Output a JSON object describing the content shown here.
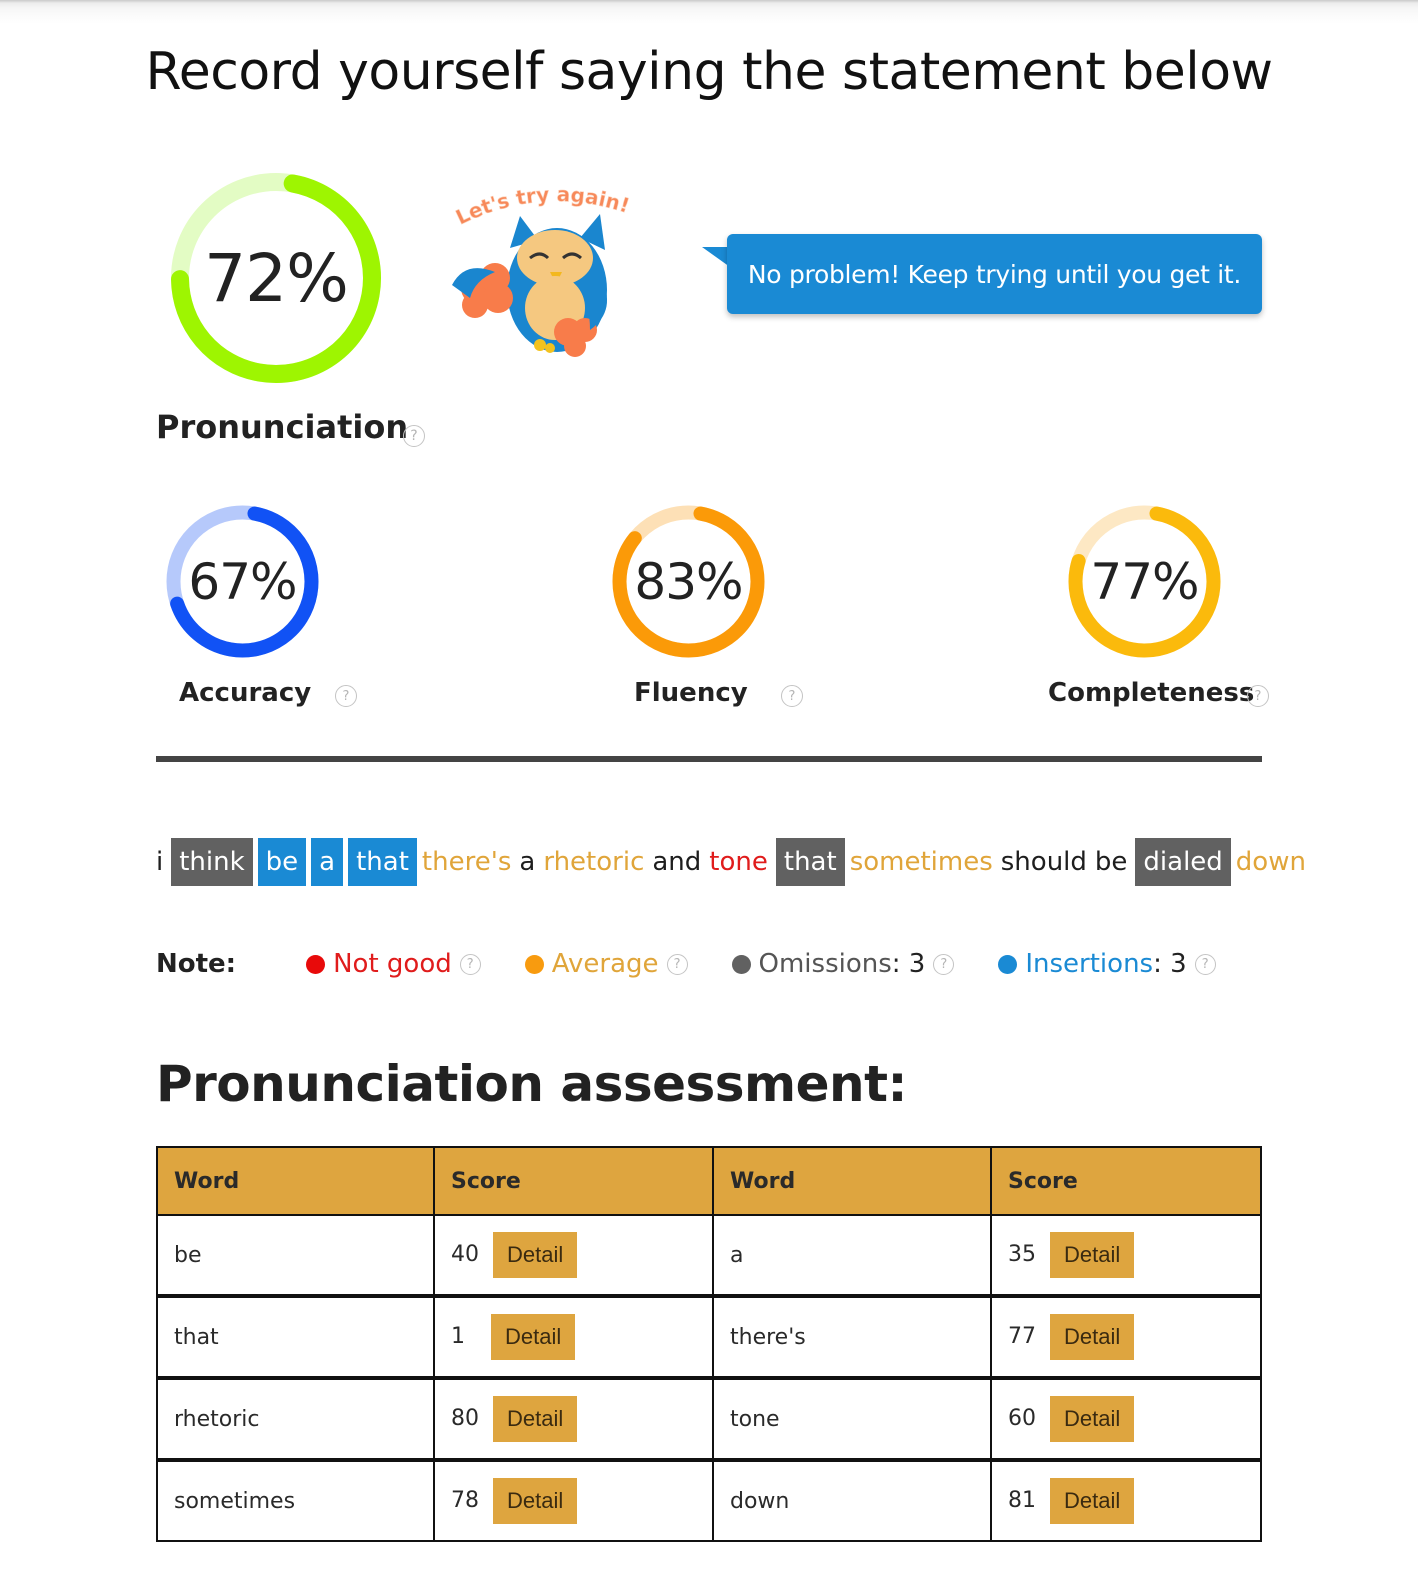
{
  "page": {
    "title": "Record yourself saying the statement below"
  },
  "main_score": {
    "label": "Pronunciation",
    "value": 72,
    "display": "72%",
    "color": "#9ef501",
    "track_color": "#e3fcc4",
    "help_icon": "question-circle-icon"
  },
  "mascot": {
    "caption": "Let's try again!",
    "icon": "owl-mascot-icon"
  },
  "feedback": {
    "message": "No problem! Keep trying until you get it."
  },
  "sub_scores": [
    {
      "label": "Accuracy",
      "value": 67,
      "display": "67%",
      "color": "#1152f5",
      "track_color": "#b6c9fb",
      "help_icon": "question-circle-icon"
    },
    {
      "label": "Fluency",
      "value": 83,
      "display": "83%",
      "color": "#fb9a08",
      "track_color": "#fde0b6",
      "help_icon": "question-circle-icon"
    },
    {
      "label": "Completeness",
      "value": 77,
      "display": "77%",
      "color": "#fbba0c",
      "track_color": "#fde8c4",
      "help_icon": "question-circle-icon"
    }
  ],
  "sentence": {
    "words": [
      {
        "text": "i",
        "status": "normal"
      },
      {
        "text": "think",
        "status": "omission"
      },
      {
        "text": "be",
        "status": "insertion"
      },
      {
        "text": "a",
        "status": "insertion"
      },
      {
        "text": "that",
        "status": "insertion"
      },
      {
        "text": "there's",
        "status": "average"
      },
      {
        "text": "a",
        "status": "normal"
      },
      {
        "text": "rhetoric",
        "status": "average"
      },
      {
        "text": "and",
        "status": "normal"
      },
      {
        "text": "tone",
        "status": "notgood"
      },
      {
        "text": "that",
        "status": "omission"
      },
      {
        "text": "sometimes",
        "status": "average"
      },
      {
        "text": "should",
        "status": "normal"
      },
      {
        "text": "be",
        "status": "normal"
      },
      {
        "text": "dialed",
        "status": "omission"
      },
      {
        "text": "down",
        "status": "average"
      }
    ]
  },
  "legend": {
    "label": "Note:",
    "items": [
      {
        "name": "Not good",
        "suffix": "",
        "color": "#e80a0a",
        "text_color": "#e01c1c"
      },
      {
        "name": "Average",
        "suffix": "",
        "color": "#f89b0f",
        "text_color": "#e0a53a"
      },
      {
        "name": "Omissions",
        "suffix": ": 3",
        "color": "#616161",
        "text_color": "#555555"
      },
      {
        "name": "Insertions",
        "suffix": ": 3",
        "color": "#1a8ad4",
        "text_color": "#1a8ad4"
      }
    ]
  },
  "assessment": {
    "heading": "Pronunciation assessment:",
    "headers": [
      "Word",
      "Score",
      "Word",
      "Score"
    ],
    "detail_label": "Detail",
    "rows": [
      [
        {
          "word": "be",
          "score": 40
        },
        {
          "word": "a",
          "score": 35
        }
      ],
      [
        {
          "word": "that",
          "score": 1
        },
        {
          "word": "there's",
          "score": 77
        }
      ],
      [
        {
          "word": "rhetoric",
          "score": 80
        },
        {
          "word": "tone",
          "score": 60
        }
      ],
      [
        {
          "word": "sometimes",
          "score": 78
        },
        {
          "word": "down",
          "score": 81
        }
      ]
    ]
  }
}
